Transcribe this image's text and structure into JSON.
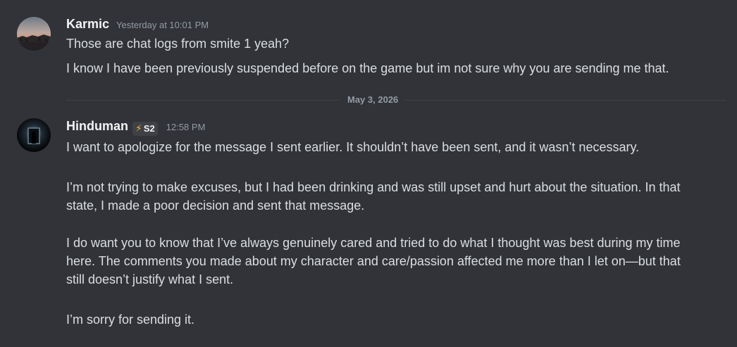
{
  "messages": [
    {
      "author": "Karmic",
      "avatar_icon": "landscape-avatar",
      "timestamp": "Yesterday at 10:01 PM",
      "lines": [
        "Those are chat logs from smite 1 yeah?",
        "I know I have been previously suspended before on the game but im not sure why you are sending me that."
      ]
    },
    {
      "author": "Hinduman",
      "avatar_icon": "dark-doorway-avatar",
      "badge": {
        "icon": "lightning-bolt-icon",
        "glyph": "⚡",
        "label": "S2"
      },
      "timestamp": "12:58 PM",
      "lines": [
        "I want to apologize for the message I sent earlier. It shouldn’t have been sent, and it wasn’t necessary.",
        "I’m not trying to make excuses, but I had been drinking and was still upset and hurt about the situation. In that",
        "state, I made a poor decision and sent that message.",
        "I do want you to know that I’ve always genuinely cared and tried to do what I thought was best during my time",
        "here. The comments you made about my character and care/passion affected me more than I let on—but that",
        "still doesn’t justify what I sent.",
        "I’m sorry for sending it."
      ]
    }
  ],
  "date_divider": "May 3, 2026",
  "colors": {
    "background": "#313338",
    "username": "#f2f3f5",
    "text": "#dbdee1",
    "muted": "#949ba4",
    "badge_bolt": "#f0b232"
  }
}
